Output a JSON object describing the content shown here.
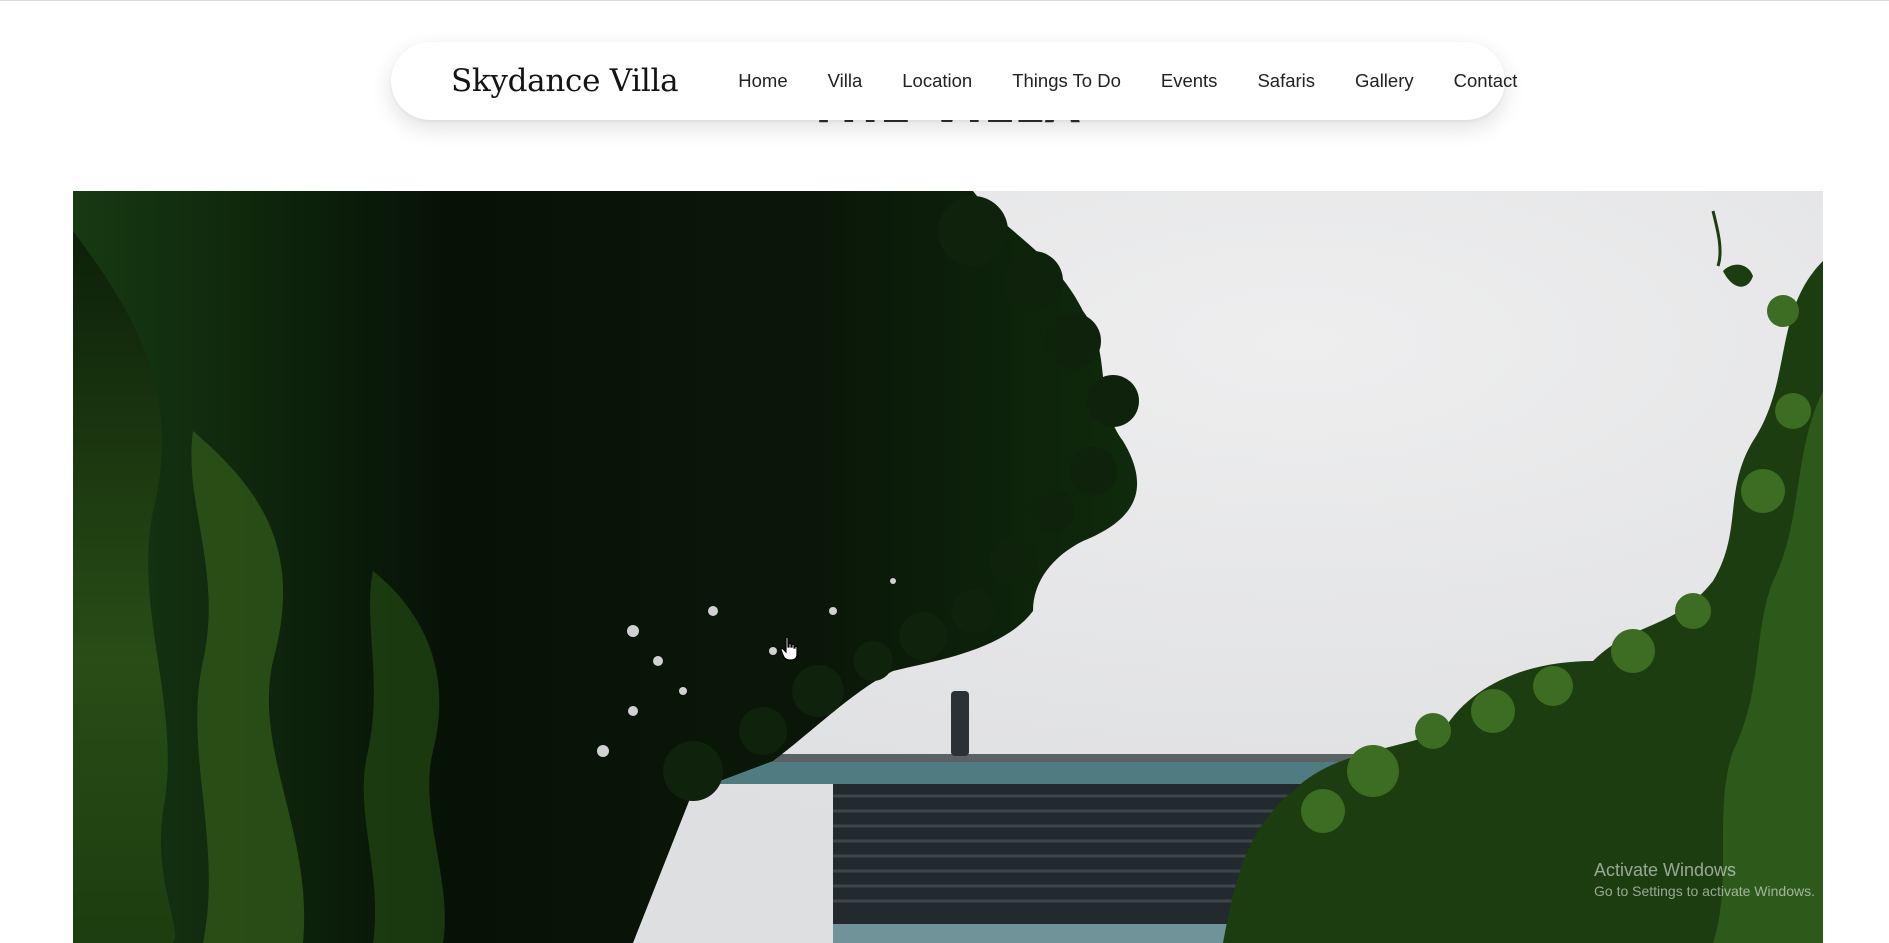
{
  "nav": {
    "brand": "Skydance Villa",
    "links": [
      "Home",
      "Villa",
      "Location",
      "Things To Do",
      "Events",
      "Safaris",
      "Gallery",
      "Contact"
    ]
  },
  "section": {
    "title": "THE VILLA"
  },
  "hero": {
    "image": "trees-and-building-photo"
  },
  "watermark": {
    "title": "Activate Windows",
    "subtitle": "Go to Settings to activate Windows."
  },
  "colors": {
    "foliage_dark": "#0b1f0a",
    "foliage": "#2f5a1e",
    "sky": "#e9e9ea",
    "brick": "#d2552e",
    "title": "#2b2f36"
  }
}
